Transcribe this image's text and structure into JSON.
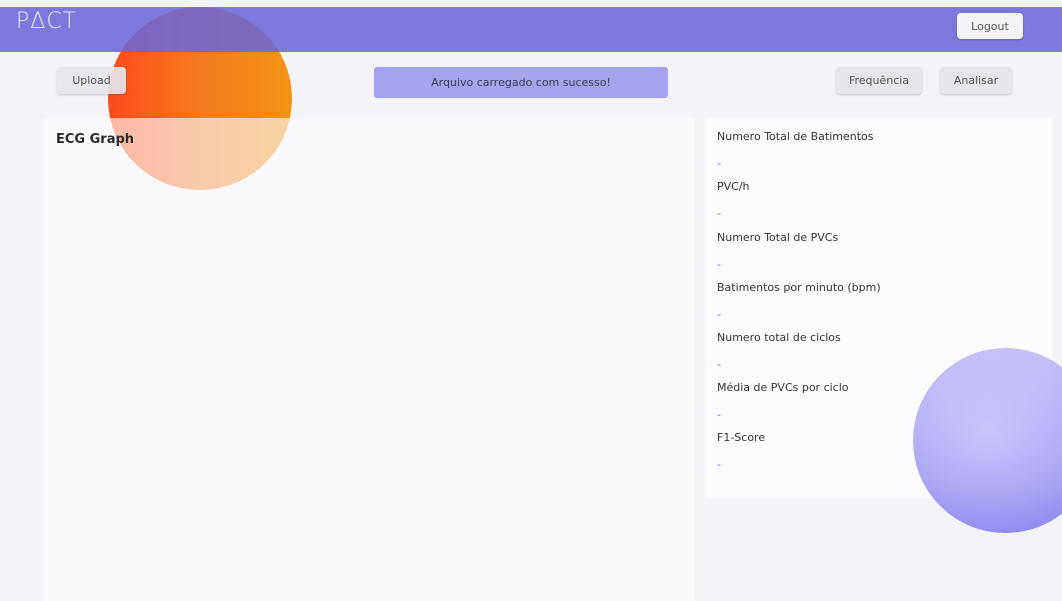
{
  "header": {
    "logo": "PΔCT",
    "logout_label": "Logout"
  },
  "toolbar": {
    "upload_label": "Upload",
    "status_message": "Arquivo carregado com sucesso!",
    "frequency_label": "Frequência",
    "analyse_label": "Analisar"
  },
  "graph": {
    "title": "ECG Graph"
  },
  "stats": [
    {
      "label": "Numero Total de Batimentos",
      "value": "-"
    },
    {
      "label": "PVC/h",
      "value": "-"
    },
    {
      "label": "Numero Total de PVCs",
      "value": "-"
    },
    {
      "label": "Batimentos por minuto (bpm)",
      "value": "-"
    },
    {
      "label": "Numero total de ciclos",
      "value": "-"
    },
    {
      "label": "Média de PVCs por ciclo",
      "value": "-"
    },
    {
      "label": "F1-Score",
      "value": "-"
    }
  ],
  "colors": {
    "header_bg": "#6c68d7",
    "accent": "#6d68d8",
    "status_bg": "#a5a3ef"
  }
}
